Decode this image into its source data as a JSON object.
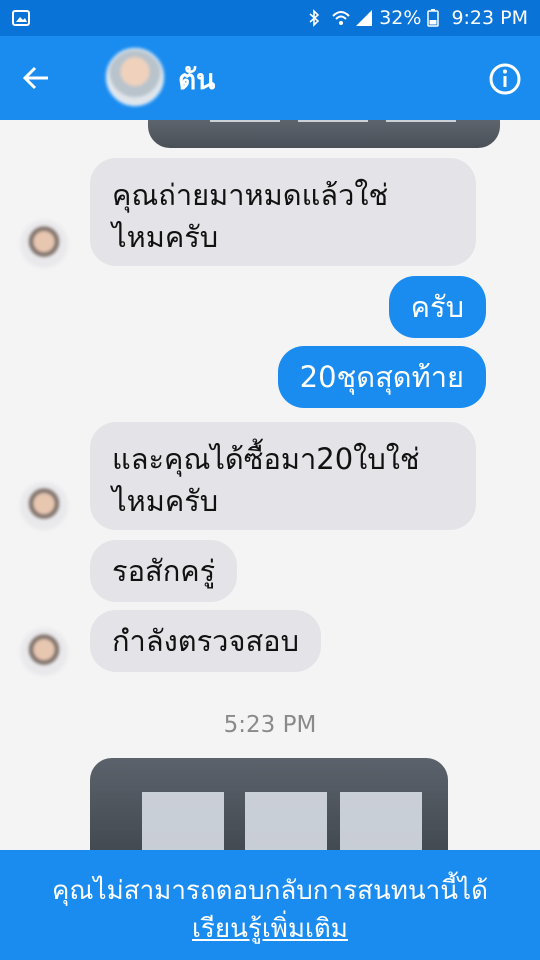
{
  "status_bar": {
    "battery": "32%",
    "time": "9:23 PM",
    "icons": [
      "image-icon",
      "bluetooth-icon",
      "wifi-icon",
      "signal-icon",
      "battery-icon"
    ]
  },
  "header": {
    "contact_name": "ตัน",
    "back_icon": "back-arrow-icon",
    "info_icon": "info-icon"
  },
  "messages": [
    {
      "side": "in",
      "text_line1": "คุณถ่ายมาหมดแล้วใช่",
      "text_line2": "ไหมครับ"
    },
    {
      "side": "out",
      "text": "ครับ"
    },
    {
      "side": "out",
      "text": "20ชุดสุดท้าย"
    },
    {
      "side": "in",
      "text_line1": "และคุณได้ซื้อมา20ใบใช่",
      "text_line2": "ไหมครับ"
    },
    {
      "side": "in",
      "text": "รอสักครู่"
    },
    {
      "side": "in",
      "text": "กำลังตรวจสอบ"
    }
  ],
  "timestamp": "5:23 PM",
  "footer": {
    "message": "คุณไม่สามารถตอบกลับการสนทนานี้ได้",
    "link": "เรียนรู้เพิ่มเติม"
  },
  "colors": {
    "status_bar": "#0a73d8",
    "header": "#1a8cf0",
    "incoming_bubble": "#e4e4e8",
    "outgoing_bubble": "#1a8cf0"
  }
}
